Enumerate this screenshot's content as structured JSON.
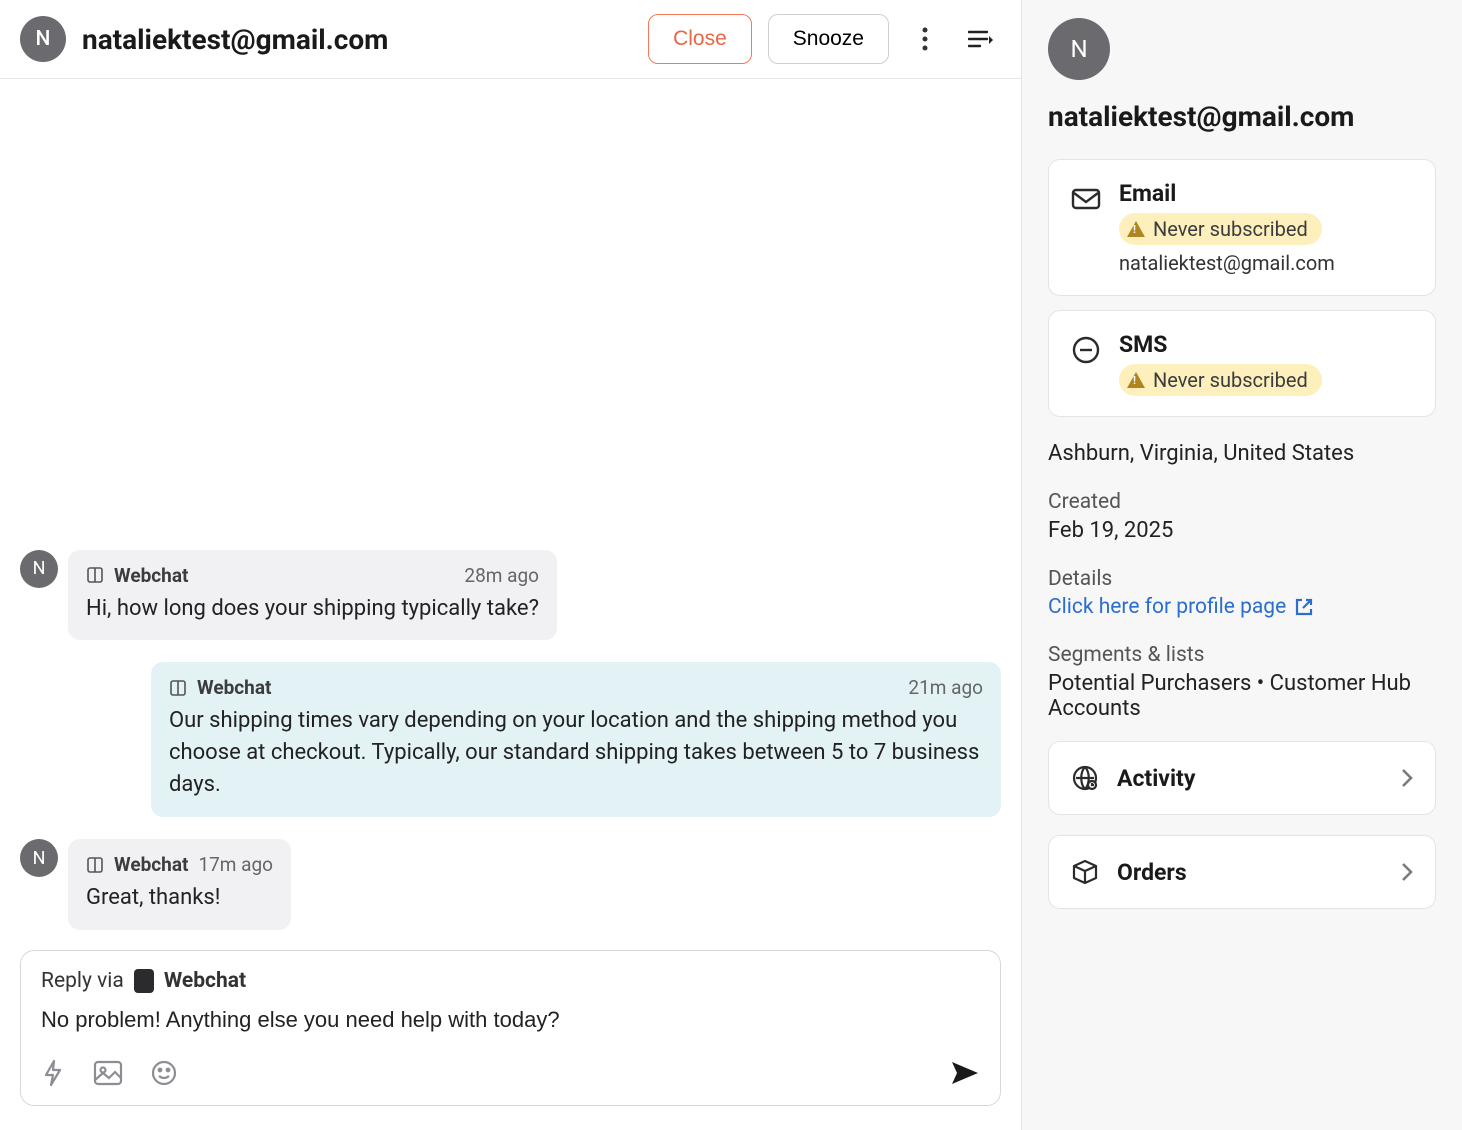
{
  "header": {
    "avatar_initial": "N",
    "title": "nataliektest@gmail.com",
    "close_label": "Close",
    "snooze_label": "Snooze"
  },
  "conversation": {
    "channel_label": "Webchat",
    "messages": [
      {
        "direction": "incoming",
        "avatar_initial": "N",
        "time": "28m ago",
        "body": "Hi, how long does your shipping typically take?"
      },
      {
        "direction": "outgoing",
        "time": "21m ago",
        "body": "Our shipping times vary depending on your location and the shipping method you choose at checkout. Typically, our standard shipping takes between 5 to 7 business days."
      },
      {
        "direction": "incoming",
        "avatar_initial": "N",
        "time": "17m ago",
        "body": "Great, thanks!"
      }
    ]
  },
  "composer": {
    "reply_via_label": "Reply via",
    "channel_label": "Webchat",
    "draft": "No problem! Anything else you need help with today?"
  },
  "profile": {
    "avatar_initial": "N",
    "name": "nataliektest@gmail.com",
    "email_card": {
      "title": "Email",
      "status": "Never subscribed",
      "value": "nataliektest@gmail.com"
    },
    "sms_card": {
      "title": "SMS",
      "status": "Never subscribed"
    },
    "location": "Ashburn, Virginia, United States",
    "created_label": "Created",
    "created_value": "Feb 19, 2025",
    "details_label": "Details",
    "details_link": "Click here for profile page",
    "segments_label": "Segments & lists",
    "segments_value": "Potential Purchasers • Customer Hub Accounts",
    "activity_label": "Activity",
    "orders_label": "Orders"
  }
}
